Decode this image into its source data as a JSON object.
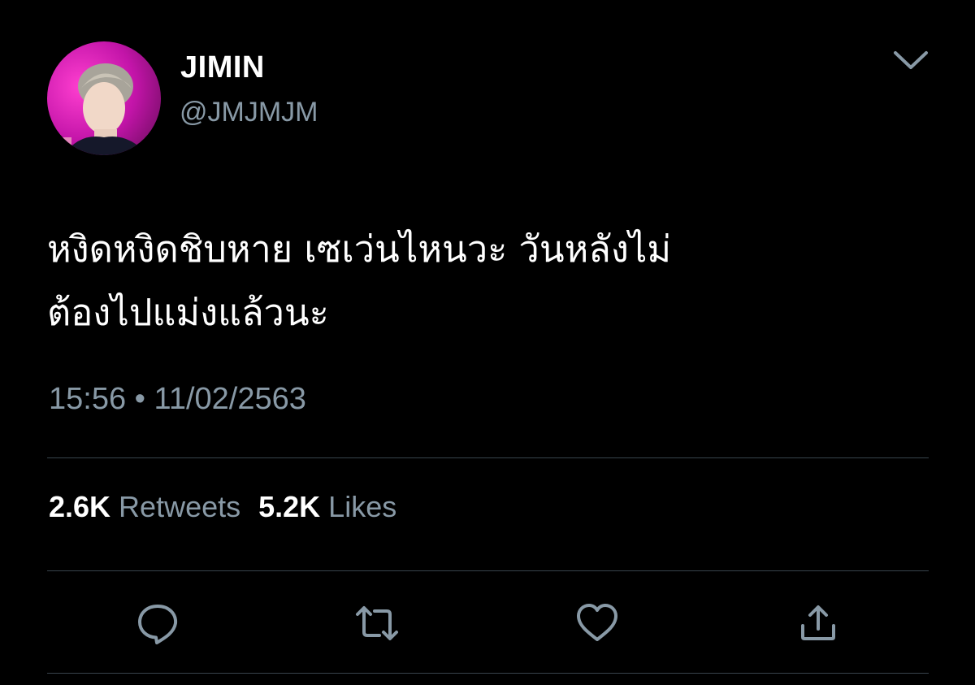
{
  "user": {
    "name": "JIMIN",
    "handle": "@JMJMJM"
  },
  "tweet": {
    "text_line1": "หงิดหงิดชิบหาย เซเว่นไหนวะ วันหลังไม่",
    "text_line2": "ต้องไปแม่งแล้วนะ",
    "time": "15:56",
    "separator": "•",
    "date": "11/02/2563"
  },
  "stats": {
    "retweets_count": "2.6K",
    "retweets_label": "Retweets",
    "likes_count": "5.2K",
    "likes_label": "Likes"
  },
  "icons": {
    "menu": "chevron-down-icon",
    "reply": "reply-icon",
    "retweet": "retweet-icon",
    "like": "heart-icon",
    "share": "share-icon"
  },
  "colors": {
    "background": "#000000",
    "text": "#ffffff",
    "secondary": "#8899a6",
    "divider": "#38444d"
  }
}
